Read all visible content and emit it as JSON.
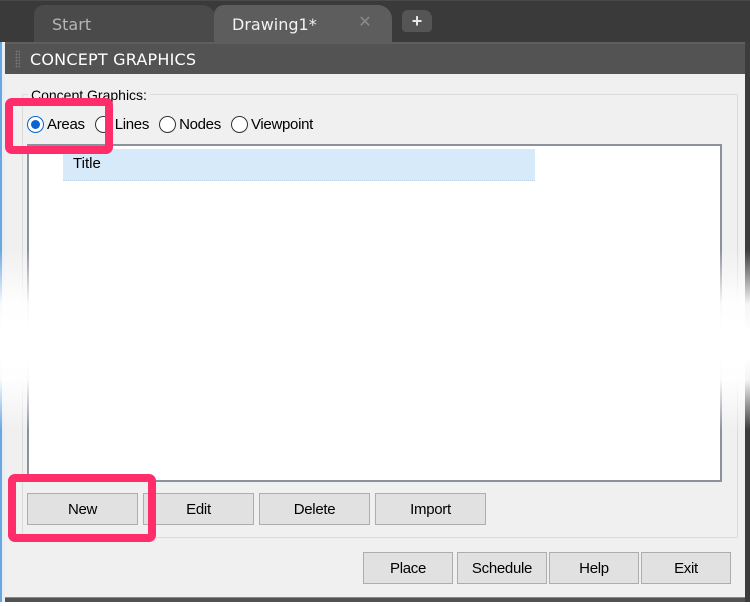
{
  "tabs": [
    {
      "label": "Start",
      "active": false
    },
    {
      "label": "Drawing1*",
      "active": true,
      "close_icon": "close-icon"
    }
  ],
  "new_tab_icon": "plus-icon",
  "palette": {
    "title": "CONCEPT GRAPHICS"
  },
  "group": {
    "label": "Concept Graphics:",
    "radios": [
      {
        "label": "Areas",
        "checked": true
      },
      {
        "label": "Lines",
        "checked": false
      },
      {
        "label": "Nodes",
        "checked": false
      },
      {
        "label": "Viewpoint",
        "checked": false
      }
    ],
    "list_items": [
      {
        "label": "Title",
        "selected": true
      }
    ],
    "buttons": {
      "new": "New",
      "edit": "Edit",
      "delete": "Delete",
      "import": "Import"
    }
  },
  "footer_buttons": {
    "place": "Place",
    "schedule": "Schedule",
    "help": "Help",
    "exit": "Exit"
  },
  "colors": {
    "highlight": "#ff2d6a",
    "selection": "#d6eaf9",
    "radio_accent": "#0a64d0"
  }
}
